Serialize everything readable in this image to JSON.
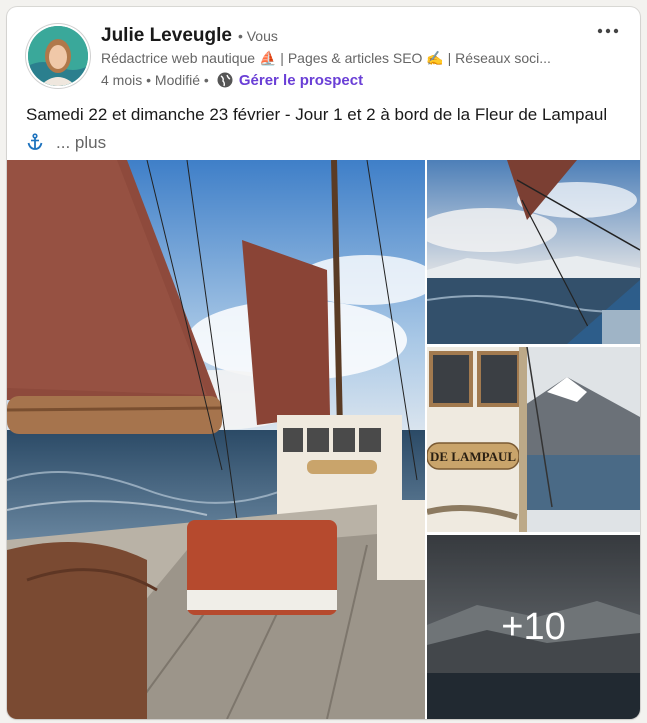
{
  "post": {
    "author_name": "Julie Leveugle",
    "degree": "• Vous",
    "headline": "Rédactrice web nautique ⛵ | Pages & articles SEO ✍️ | Réseaux soci...",
    "timestamp": "4 mois • Modifié •",
    "manage_label": "Gérer le prospect",
    "more_icon": "more-horizontal-icon",
    "text": "Samedi 22 et dimanche 23 février - Jour 1 et 2 à bord de la Fleur de Lampaul",
    "anchor_icon": "⚓",
    "see_more": "... plus"
  },
  "images": {
    "boat_name": "DE LAMPAUL",
    "extra_count": "+10"
  },
  "colors": {
    "accent": "#6a3fd6",
    "sail": "#8e4a3c"
  }
}
